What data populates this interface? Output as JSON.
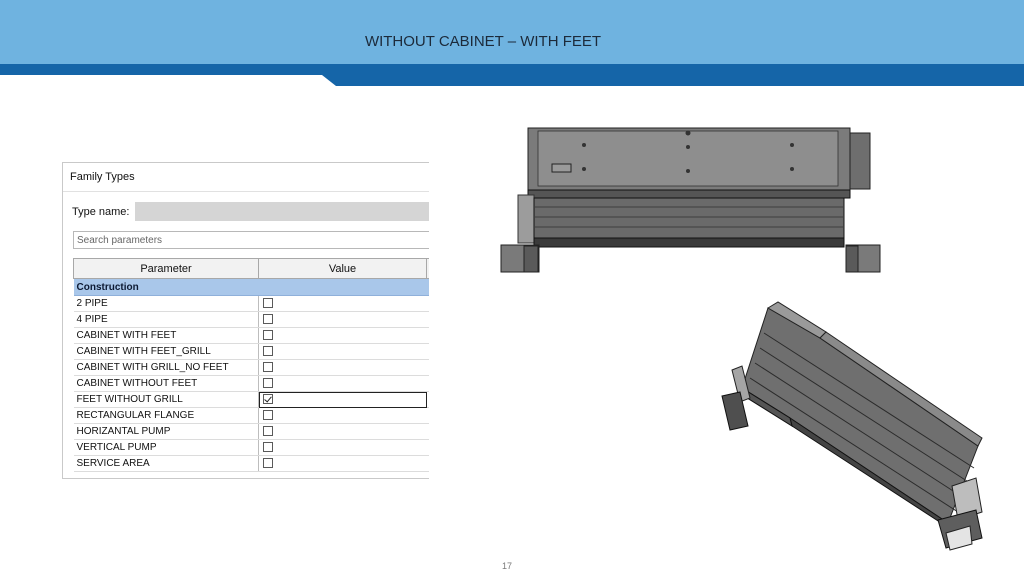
{
  "slide": {
    "title": "WITHOUT CABINET – WITH FEET",
    "page_number": "17",
    "colors": {
      "banner": "#6fb3e0",
      "stripe": "#1565a8",
      "header_group": "#a9c7ea"
    }
  },
  "dialog": {
    "title": "Family Types",
    "type_name_label": "Type name:",
    "type_name_value": "",
    "search_placeholder": "Search parameters",
    "columns": [
      "Parameter",
      "Value"
    ],
    "group": "Construction",
    "rows": [
      {
        "name": "2 PIPE",
        "checked": false
      },
      {
        "name": "4 PIPE",
        "checked": false
      },
      {
        "name": "CABINET WITH FEET",
        "checked": false
      },
      {
        "name": "CABINET WITH FEET_GRILL",
        "checked": false
      },
      {
        "name": "CABINET WITH GRILL_NO FEET",
        "checked": false
      },
      {
        "name": "CABINET WITHOUT FEET",
        "checked": false
      },
      {
        "name": "FEET WITHOUT GRILL",
        "checked": true
      },
      {
        "name": "RECTANGULAR FLANGE",
        "checked": false
      },
      {
        "name": "HORIZANTAL PUMP",
        "checked": false
      },
      {
        "name": "VERTICAL PUMP",
        "checked": false
      },
      {
        "name": "SERVICE AREA",
        "checked": false
      }
    ]
  },
  "images": {
    "front": "unit-front-view",
    "iso": "unit-isometric-view"
  }
}
